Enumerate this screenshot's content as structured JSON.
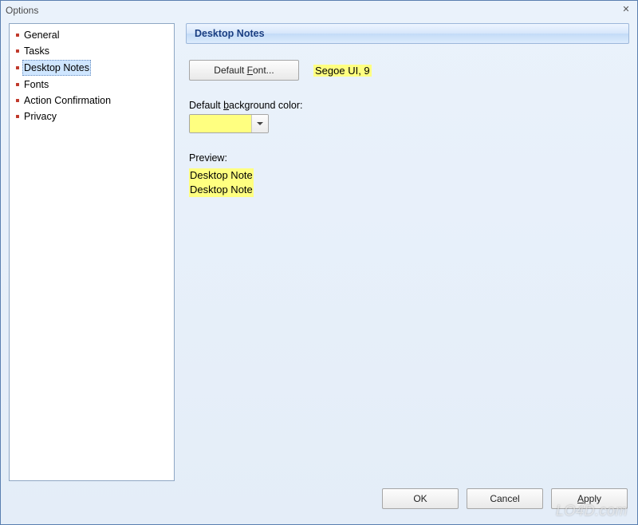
{
  "window": {
    "title": "Options"
  },
  "sidebar": {
    "items": [
      {
        "label": "General",
        "selected": false
      },
      {
        "label": "Tasks",
        "selected": false
      },
      {
        "label": "Desktop Notes",
        "selected": true
      },
      {
        "label": "Fonts",
        "selected": false
      },
      {
        "label": "Action Confirmation",
        "selected": false
      },
      {
        "label": "Privacy",
        "selected": false
      }
    ]
  },
  "panel": {
    "title": "Desktop Notes",
    "default_font_button_pre": "Default ",
    "default_font_button_u": "F",
    "default_font_button_post": "ont...",
    "font_display": "Segoe UI, 9",
    "bg_label_pre": "Default ",
    "bg_label_u": "b",
    "bg_label_post": "ackground color:",
    "bg_color": "#ffff80",
    "preview_label": "Preview:",
    "preview_lines": [
      "Desktop Note",
      "Desktop Note"
    ]
  },
  "buttons": {
    "ok": "OK",
    "cancel": "Cancel",
    "apply_u": "A",
    "apply_post": "pply"
  },
  "watermark": "LO4D.com"
}
